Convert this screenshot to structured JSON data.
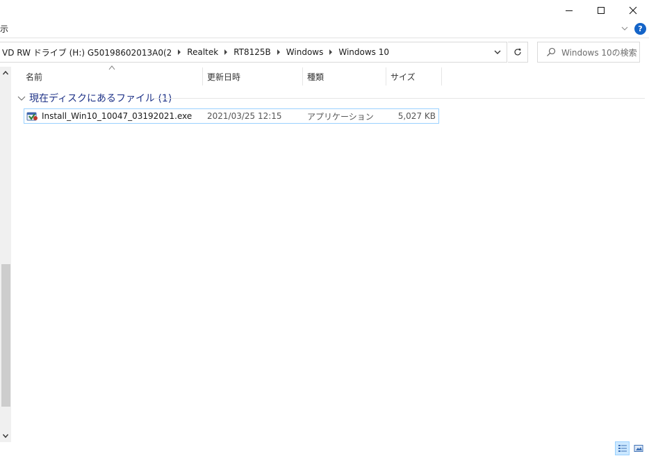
{
  "window": {
    "minimize_icon": "minimize-icon",
    "maximize_icon": "maximize-icon",
    "close_icon": "close-icon"
  },
  "ribbon": {
    "label": "示",
    "help": "?"
  },
  "address": {
    "crumbs": [
      "VD RW ドライブ (H:) G50198602013A0(2",
      "Realtek",
      "RT8125B",
      "Windows",
      "Windows 10"
    ]
  },
  "search": {
    "placeholder": "Windows 10の検索"
  },
  "columns": {
    "name": "名前",
    "date": "更新日時",
    "type": "種類",
    "size": "サイズ"
  },
  "group": {
    "title": "現在ディスクにあるファイル (1)"
  },
  "files": [
    {
      "name": "Install_Win10_10047_03192021.exe",
      "date": "2021/03/25 12:15",
      "type": "アプリケーション",
      "size": "5,027 KB"
    }
  ],
  "colors": {
    "accent": "#1464c8",
    "group_title": "#1e3287",
    "selection_border": "#99d1ff",
    "selection_fill": "#cce8ff"
  }
}
